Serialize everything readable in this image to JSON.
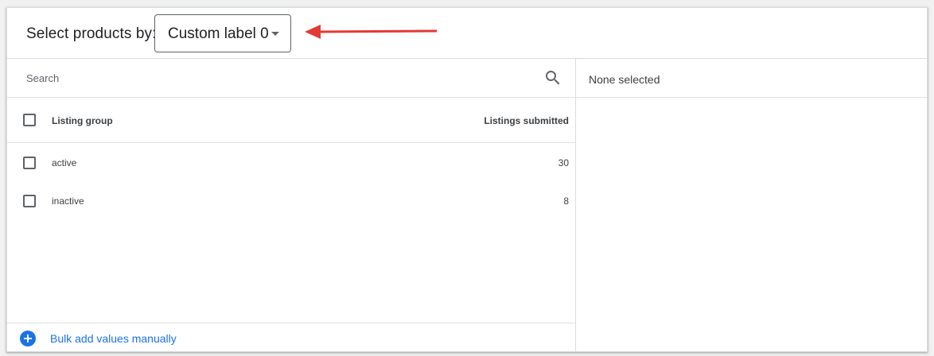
{
  "header": {
    "label": "Select products by:",
    "dropdown_value": "Custom label 0"
  },
  "search": {
    "placeholder": "Search"
  },
  "table": {
    "columns": [
      "Listing group",
      "Listings submitted"
    ],
    "rows": [
      {
        "label": "active",
        "value": "30"
      },
      {
        "label": "inactive",
        "value": "8"
      }
    ]
  },
  "footer": {
    "link_label": "Bulk add values manually"
  },
  "right_pane": {
    "status": "None selected"
  },
  "colors": {
    "accent": "#1a73e8",
    "annotation": "#e53935"
  },
  "icons": {
    "search": "search-icon",
    "add": "add-circle-icon",
    "caret": "caret-down-icon",
    "annotation": "arrow-left-icon"
  }
}
